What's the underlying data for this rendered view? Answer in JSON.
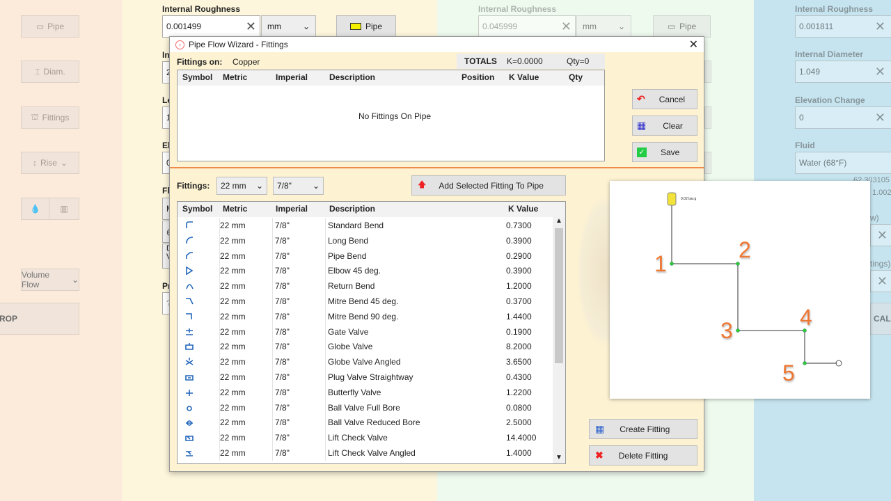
{
  "left_panel": {
    "pipe": "Pipe",
    "diam": "Diam.",
    "fittings": "Fittings",
    "rise": "Rise",
    "volume_flow": "Volume Flow",
    "calc": "ROP"
  },
  "col2": {
    "label": "Internal Roughness",
    "value": "0.001499",
    "unit": "mm",
    "pipe": "Pipe",
    "partial_labels": [
      "In",
      "Le",
      "El",
      "Fl",
      "Pr"
    ],
    "partial_values": [
      "2",
      "1",
      "0",
      "M",
      "@",
      "D",
      "V",
      "?"
    ]
  },
  "col3": {
    "label": "Internal Roughness",
    "value": "0.045999",
    "unit": "mm",
    "pipe": "Pipe"
  },
  "col4": {
    "fields": [
      {
        "label": "Internal Roughness",
        "value": "0.001811"
      },
      {
        "label": "Internal Diameter",
        "value": "1.049"
      },
      {
        "label": "Elevation Change",
        "value": "0"
      },
      {
        "label": "Fluid",
        "value": "Water (68°F)"
      }
    ],
    "density": "62.303105",
    "viscosity": "1.002",
    "partial1": "w)",
    "partial2": "tings)",
    "calc": "CALC"
  },
  "dialog": {
    "title": "Pipe Flow Wizard - Fittings",
    "fittings_on_label": "Fittings on:",
    "fittings_on_value": "Copper",
    "totals_label": "TOTALS",
    "totals_k": "K=0.0000",
    "totals_qty": "Qty=0",
    "top_headers": [
      "Symbol",
      "Metric",
      "Imperial",
      "Description",
      "Position",
      "K Value",
      "Qty"
    ],
    "empty_text": "No Fittings On Pipe",
    "cancel": "Cancel",
    "clear": "Clear",
    "save": "Save",
    "fittings_label": "Fittings:",
    "metric_select": "22 mm",
    "imperial_select": "7/8\"",
    "add_button": "Add Selected Fitting To Pipe",
    "list_headers": [
      "Symbol",
      "Metric",
      "Imperial",
      "Description",
      "K Value"
    ],
    "rows": [
      [
        "22 mm",
        "7/8\"",
        "Standard Bend",
        "0.7300"
      ],
      [
        "22 mm",
        "7/8\"",
        "Long Bend",
        "0.3900"
      ],
      [
        "22 mm",
        "7/8\"",
        "Pipe Bend",
        "0.2900"
      ],
      [
        "22 mm",
        "7/8\"",
        "Elbow 45 deg.",
        "0.3900"
      ],
      [
        "22 mm",
        "7/8\"",
        "Return Bend",
        "1.2000"
      ],
      [
        "22 mm",
        "7/8\"",
        "Mitre Bend 45 deg.",
        "0.3700"
      ],
      [
        "22 mm",
        "7/8\"",
        "Mitre Bend 90 deg.",
        "1.4400"
      ],
      [
        "22 mm",
        "7/8\"",
        "Gate Valve",
        "0.1900"
      ],
      [
        "22 mm",
        "7/8\"",
        "Globe Valve",
        "8.2000"
      ],
      [
        "22 mm",
        "7/8\"",
        "Globe Valve Angled",
        "3.6500"
      ],
      [
        "22 mm",
        "7/8\"",
        "Plug Valve Straightway",
        "0.4300"
      ],
      [
        "22 mm",
        "7/8\"",
        "Butterfly Valve",
        "1.2200"
      ],
      [
        "22 mm",
        "7/8\"",
        "Ball Valve Full Bore",
        "0.0800"
      ],
      [
        "22 mm",
        "7/8\"",
        "Ball Valve Reduced Bore",
        "2.5000"
      ],
      [
        "22 mm",
        "7/8\"",
        "Lift Check Valve",
        "14.4000"
      ],
      [
        "22 mm",
        "7/8\"",
        "Lift Check Valve Angled",
        "1.4000"
      ]
    ],
    "create_fitting": "Create Fitting",
    "delete_fitting": "Delete Fitting"
  },
  "diagram": {
    "tank_label": "0.02 bar.g",
    "nodes": [
      "1",
      "2",
      "3",
      "4",
      "5"
    ]
  },
  "colors": {
    "accent_orange": "#ee7733",
    "node_green": "#33cc33",
    "tank_yellow": "#f2e23a"
  }
}
